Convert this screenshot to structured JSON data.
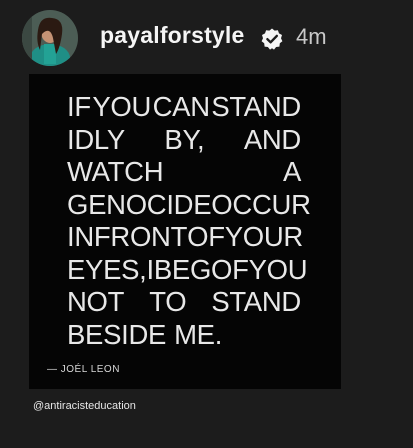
{
  "story": {
    "username": "payalforstyle",
    "time_ago": "4m",
    "avatar_icon": "profile-avatar",
    "verified_icon": "verified-badge-icon"
  },
  "quote": {
    "lines": [
      [
        "IF",
        "YOU",
        "CAN",
        "STAND"
      ],
      [
        "IDLY",
        "BY,",
        "AND"
      ],
      [
        "WATCH",
        "A"
      ],
      [
        "GENOCIDE",
        "OCCUR"
      ],
      [
        "IN",
        "FRONT",
        "OF",
        "YOUR"
      ],
      [
        "EYES,",
        "I",
        "BEG",
        "OF",
        "YOU"
      ],
      [
        "NOT",
        "TO",
        "STAND"
      ],
      [
        "BESIDE",
        "ME."
      ]
    ],
    "attribution": "— JOÉL LEON"
  },
  "tag": {
    "handle": "@antiracisteducation"
  },
  "colors": {
    "background": "#1c1c1c",
    "card": "#050505",
    "text": "#e8e8e8"
  }
}
